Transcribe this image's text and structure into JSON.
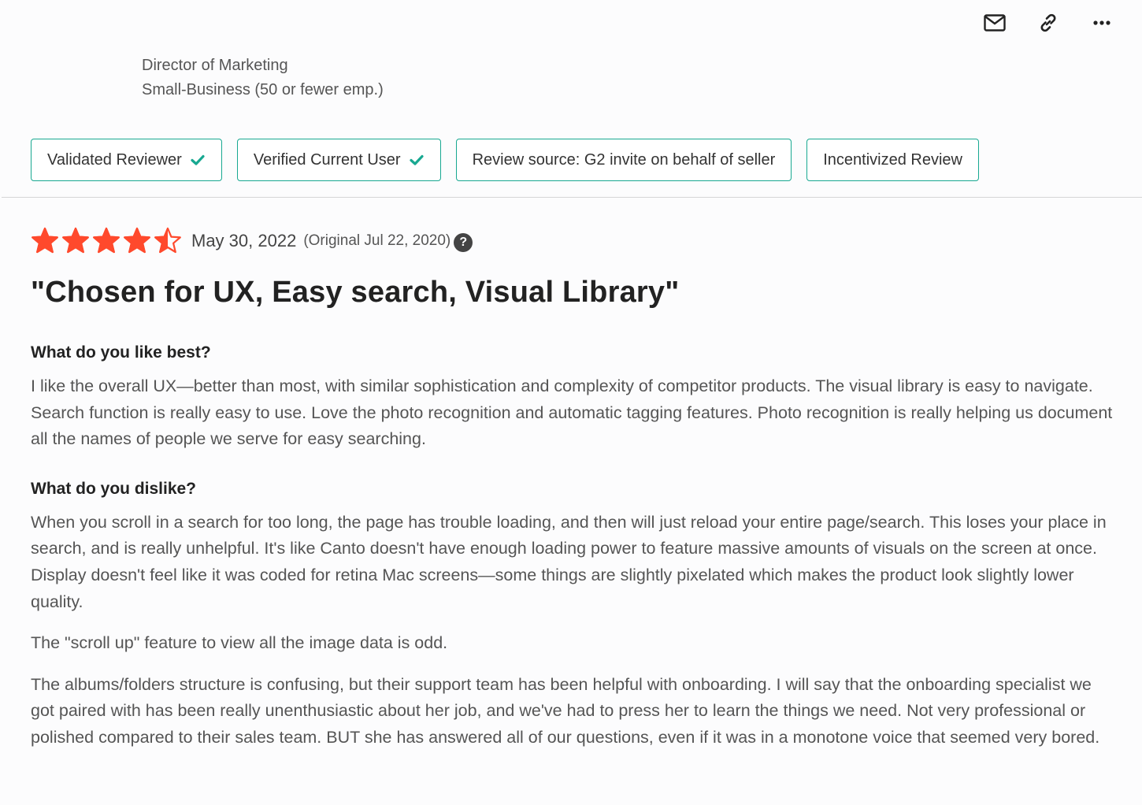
{
  "actions": {
    "email": "envelope-icon",
    "link": "link-icon",
    "more": "more-horizontal-icon"
  },
  "reviewer": {
    "title": "Director of Marketing",
    "segment": "Small-Business (50 or fewer emp.)"
  },
  "badges": [
    {
      "label": "Validated Reviewer",
      "check": true
    },
    {
      "label": "Verified Current User",
      "check": true
    },
    {
      "label": "Review source: G2 invite on behalf of seller",
      "check": false
    },
    {
      "label": "Incentivized Review",
      "check": false
    }
  ],
  "rating": {
    "value": 4.5,
    "max": 5,
    "color": "#ff492c",
    "date": "May 30, 2022",
    "original": "(Original Jul 22, 2020)",
    "help": "?"
  },
  "review": {
    "title": "\"Chosen for UX, Easy search, Visual Library\"",
    "sections": [
      {
        "question": "What do you like best?",
        "paragraphs": [
          "I like the overall UX—better than most, with similar sophistication and complexity of competitor products. The visual library is easy to navigate. Search function is really easy to use. Love the photo recognition and automatic tagging features. Photo recognition is really helping us document all the names of people we serve for easy searching."
        ]
      },
      {
        "question": "What do you dislike?",
        "paragraphs": [
          "When you scroll in a search for too long, the page has trouble loading, and then will just reload your entire page/search. This loses your place in search, and is really unhelpful. It's like Canto doesn't have enough loading power to feature massive amounts of visuals on the screen at once. Display doesn't feel like it was coded for retina Mac screens—some things are slightly pixelated which makes the product look slightly lower quality.",
          "The \"scroll up\" feature to view all the image data is odd.",
          "The albums/folders structure is confusing, but their support team has been helpful with onboarding. I will say that the onboarding specialist we got paired with has been really unenthusiastic about her job, and we've had to press her to learn the things we need. Not very professional or polished compared to their sales team. BUT she has answered all of our questions, even if it was in a monotone voice that seemed very bored."
        ]
      }
    ]
  },
  "colors": {
    "accent": "#18a891",
    "star": "#ff492c"
  }
}
